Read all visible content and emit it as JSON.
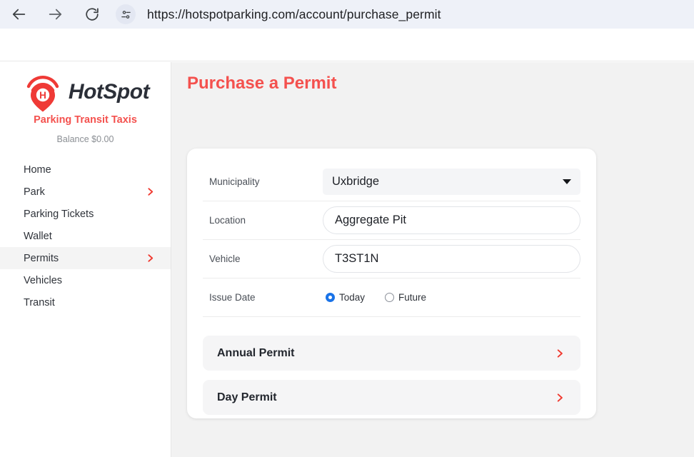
{
  "browser": {
    "back_icon": "back-arrow-icon",
    "forward_icon": "forward-arrow-icon",
    "reload_icon": "reload-icon",
    "site_settings_icon": "site-settings-sliders-icon",
    "url": "https://hotspotparking.com/account/purchase_permit"
  },
  "sidebar": {
    "logo_icon": "hotspot-location-pin-icon",
    "brand_name": "HotSpot",
    "tagline": "Parking Transit Taxis",
    "balance": "Balance $0.00",
    "items": [
      {
        "label": "Home",
        "chevron": false,
        "active": false
      },
      {
        "label": "Park",
        "chevron": true,
        "active": false
      },
      {
        "label": "Parking Tickets",
        "chevron": false,
        "active": false
      },
      {
        "label": "Wallet",
        "chevron": false,
        "active": false
      },
      {
        "label": "Permits",
        "chevron": true,
        "active": true
      },
      {
        "label": "Vehicles",
        "chevron": false,
        "active": false
      },
      {
        "label": "Transit",
        "chevron": false,
        "active": false
      }
    ]
  },
  "main": {
    "page_title": "Purchase a Permit",
    "form": {
      "municipality": {
        "label": "Municipality",
        "value": "Uxbridge",
        "caret_icon": "chevron-down-icon"
      },
      "location": {
        "label": "Location",
        "value": "Aggregate Pit",
        "placeholder": "Location"
      },
      "vehicle": {
        "label": "Vehicle",
        "value": "T3ST1N",
        "placeholder": "Vehicle"
      },
      "issue_date": {
        "label": "Issue Date",
        "options": [
          {
            "label": "Today",
            "selected": true
          },
          {
            "label": "Future",
            "selected": false
          }
        ]
      }
    },
    "permit_options": [
      {
        "label": "Annual Permit",
        "chevron_icon": "chevron-right-icon"
      },
      {
        "label": "Day Permit",
        "chevron_icon": "chevron-right-icon"
      }
    ]
  },
  "colors": {
    "brand_red": "#f4514e",
    "chevron_red": "#f0392f",
    "radio_blue": "#1a73e8",
    "page_bg": "#f2f2f2",
    "omnibox_bg": "#eef1f8"
  }
}
